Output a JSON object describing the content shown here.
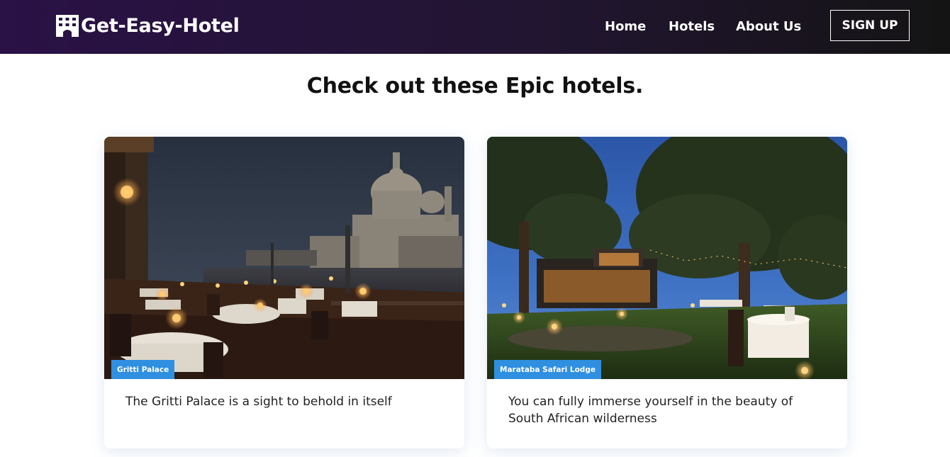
{
  "brand": {
    "name": "Get-Easy-Hotel",
    "icon": "hotel-building-icon"
  },
  "nav": {
    "links": [
      "Home",
      "Hotels",
      "About Us"
    ],
    "signup_label": "SIGN UP"
  },
  "main": {
    "title": "Check out these Epic hotels."
  },
  "hotels": [
    {
      "tag": "Gritti Palace",
      "description": "The Gritti Palace is a sight to behold in itself",
      "image": "venice-canal-dining-terrace-at-dusk"
    },
    {
      "tag": "Marataba Safari Lodge",
      "description": "You can fully immerse yourself in the beauty of South African wilderness",
      "image": "safari-lodge-lawn-with-lantern-lit-dinner-table"
    }
  ],
  "colors": {
    "navbar_start": "#2a1146",
    "navbar_end": "#141414",
    "tag_background": "#2f8fe0",
    "text_dark": "#111111"
  }
}
